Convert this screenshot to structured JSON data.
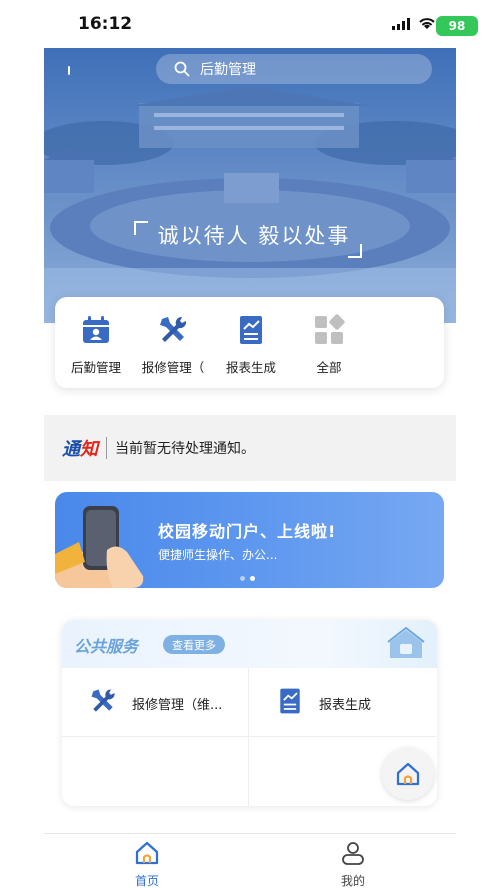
{
  "status_bar": {
    "time": "16:12",
    "battery": "98"
  },
  "hero": {
    "search_placeholder": "后勤管理",
    "slogan": "诚以待人 毅以处事"
  },
  "quick_menu": [
    {
      "label": "后勤管理",
      "icon": "calendar-person-icon"
    },
    {
      "label": "报修管理（",
      "icon": "tools-icon"
    },
    {
      "label": "报表生成",
      "icon": "report-chart-icon"
    },
    {
      "label": "全部",
      "icon": "grid-all-icon"
    }
  ],
  "notice": {
    "title_a": "通",
    "title_b": "知",
    "text": "当前暂无待处理通知。"
  },
  "banner": {
    "title": "校园移动门户、上线啦!",
    "subtitle": "便捷师生操作、办公..."
  },
  "services": {
    "title": "公共服务",
    "more_label": "查看更多",
    "items": [
      {
        "label": "报修管理（维...",
        "icon": "tools-icon"
      },
      {
        "label": "报表生成",
        "icon": "report-chart-icon"
      }
    ]
  },
  "tabbar": {
    "home_label": "首页",
    "mine_label": "我的"
  },
  "colors": {
    "primary": "#3a6bc4",
    "banner": "#5d97ef",
    "active_tab": "#2f6fd6",
    "notice_red": "#e2261c"
  }
}
